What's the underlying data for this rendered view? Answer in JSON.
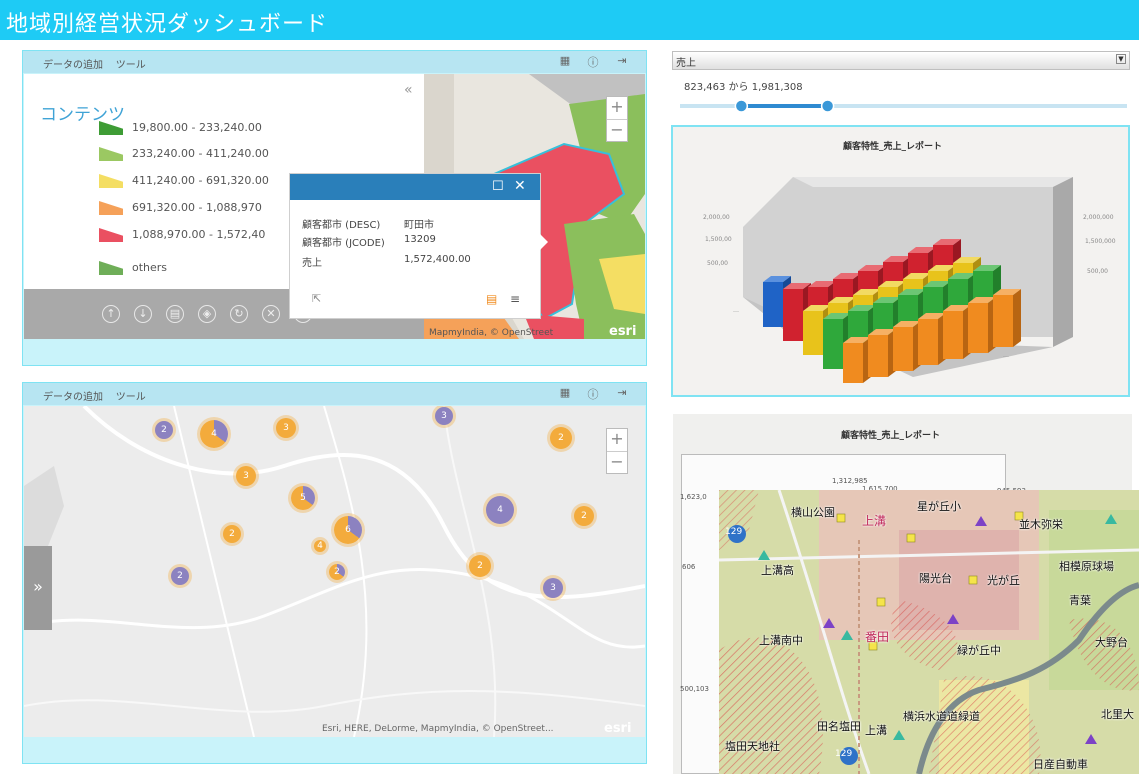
{
  "header": {
    "title": "地域別経営状況ダッシュボード"
  },
  "panel1": {
    "toolbar": {
      "add_data": "データの追加",
      "tools": "ツール"
    },
    "legend": {
      "heading": "コンテンツ",
      "items": [
        {
          "label": "19,800.00 - 233,240.00",
          "color": "#3e9c35"
        },
        {
          "label": "233,240.00 - 411,240.00",
          "color": "#9bc862"
        },
        {
          "label": "411,240.00 - 691,320.00",
          "color": "#f4de63"
        },
        {
          "label": "691,320.00 - 1,088,970",
          "color": "#f5a159"
        },
        {
          "label": "1,088,970.00 - 1,572,40",
          "color": "#ea5061"
        },
        {
          "label": "others",
          "color": "#6fae58"
        }
      ]
    },
    "popup": {
      "rows": [
        {
          "key": "顧客都市 (DESC)",
          "value": "町田市"
        },
        {
          "key": "顧客都市 (JCODE)",
          "value": "13209"
        },
        {
          "key": "売上",
          "value": "1,572,400.00"
        }
      ]
    },
    "attribution": "MapmyIndia, © OpenStreet",
    "esri": "esri"
  },
  "panel2": {
    "toolbar": {
      "add_data": "データの追加",
      "tools": "ツール"
    },
    "attribution": "Esri, HERE, DeLorme, MapmyIndia, © OpenStreet...",
    "esri": "esri",
    "clusters": [
      "2",
      "4",
      "3",
      "3",
      "3",
      "5",
      "4",
      "2",
      "2",
      "6",
      "2",
      "4",
      "2",
      "2",
      "2",
      "3"
    ]
  },
  "filter": {
    "field": "売上",
    "range_text": "823,463 から 1,981,308",
    "low": 823463,
    "high": 1981308
  },
  "chart1": {
    "title": "顧客特性_売上_レポート"
  },
  "chart2": {
    "title": "顧客特性_売上_レポート",
    "data_labels": [
      "1,312,985",
      "1,615,700",
      "1,623,0",
      "945,593",
      "606",
      "500,103"
    ]
  },
  "overlay_map": {
    "labels": [
      "横山公園",
      "上溝",
      "星が丘小",
      "並木弥栄",
      "上溝高",
      "陽光台",
      "光が丘",
      "相模原球場",
      "青葉",
      "上溝南中",
      "番田",
      "緑が丘中",
      "大野台",
      "田名塩田",
      "上溝",
      "横浜水道道緑道",
      "北里大",
      "塩田天地社",
      "日産自動車",
      "129",
      "129"
    ]
  },
  "colors": {
    "title_bar": "#1ecbf5",
    "panel_bg": "#c9f3fa",
    "accent_blue": "#2a7fba",
    "cluster_orange": "#f3ab3c",
    "cluster_purple": "#8c82c0"
  },
  "icons": [
    "grid-icon",
    "help-icon",
    "logout-icon",
    "collapse-icon",
    "maximize-icon",
    "close-icon",
    "expand-icon"
  ]
}
